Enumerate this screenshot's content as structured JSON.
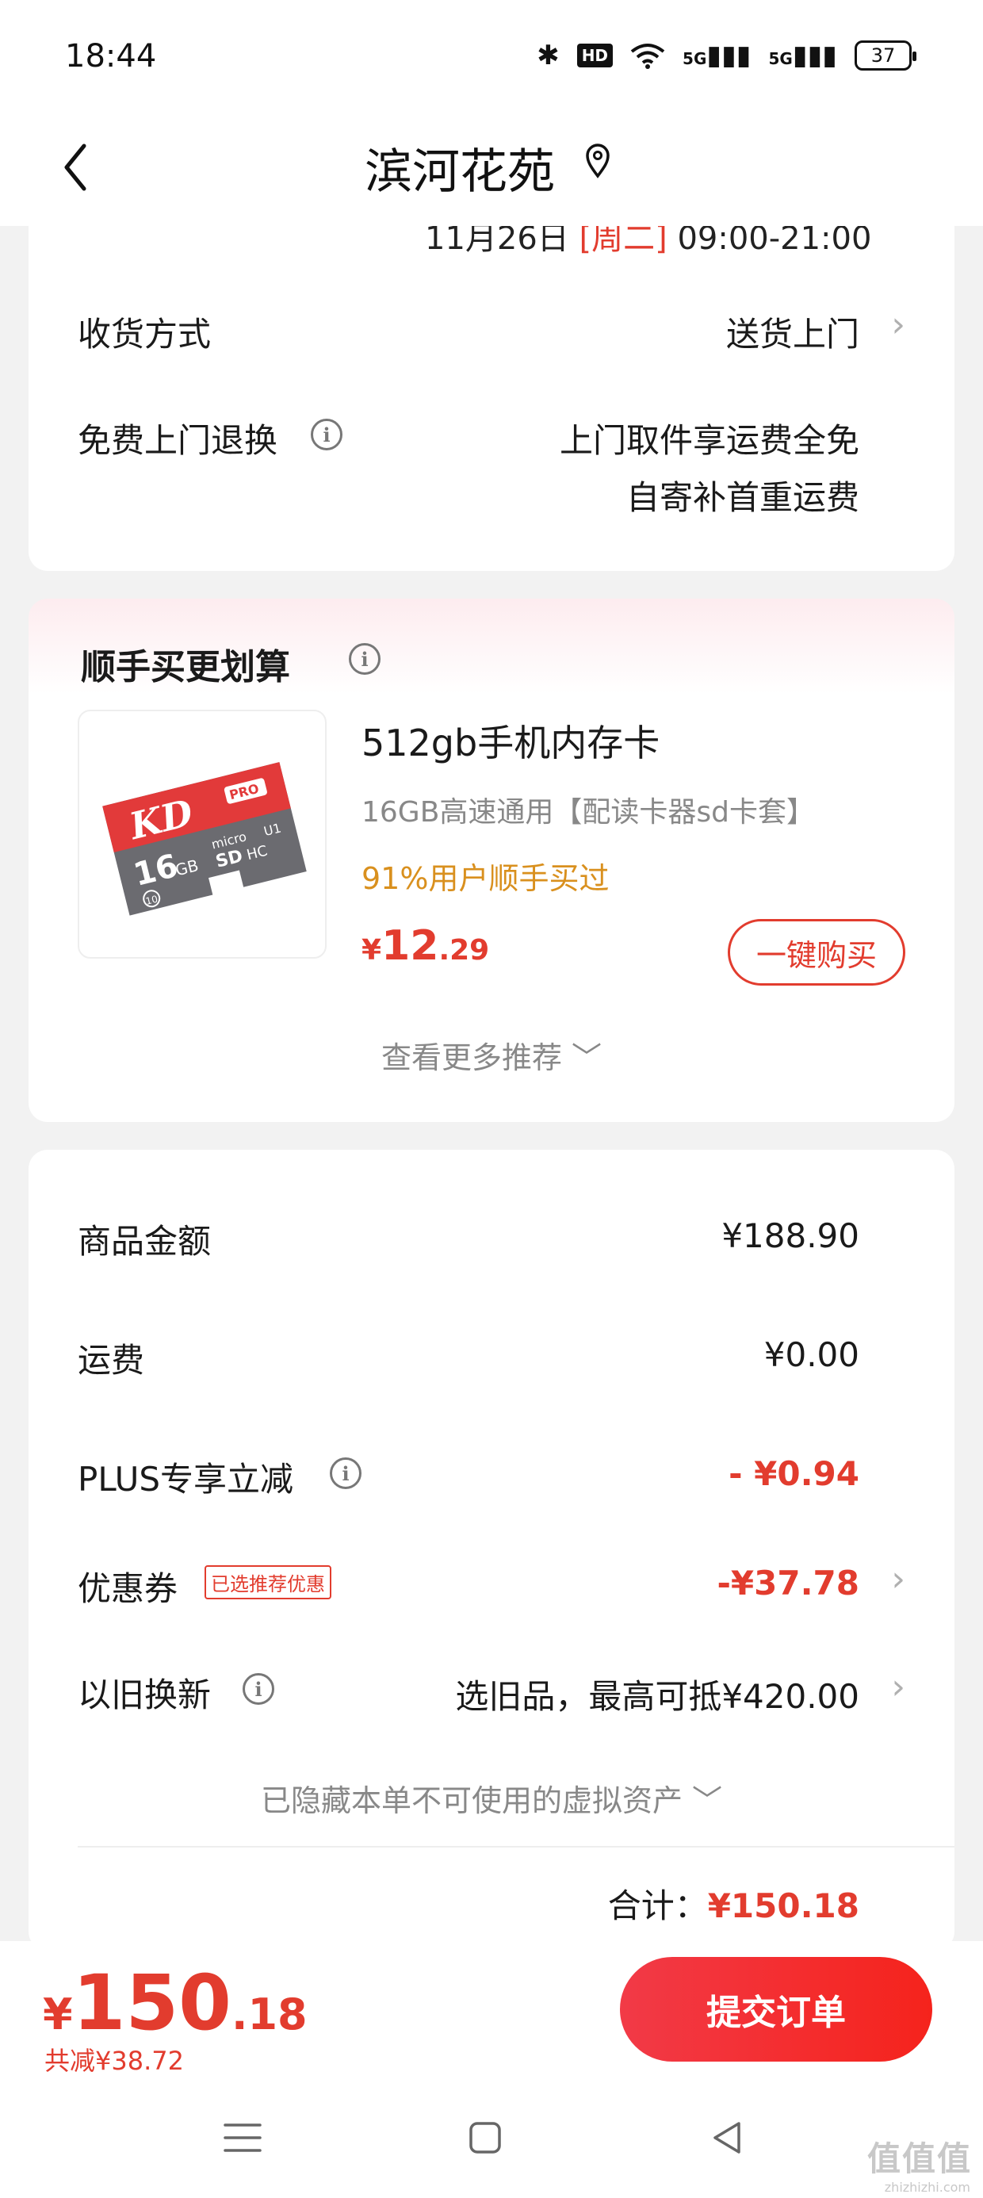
{
  "status_bar": {
    "time": "18:44",
    "hd": "HD",
    "signal1": "5G",
    "signal2": "5G",
    "battery": "37"
  },
  "nav": {
    "title": "滨河花苑"
  },
  "delivery": {
    "cut_line_prefix": "11月26日",
    "cut_line_day": "[周二]",
    "cut_line_time": "09:00-21:00",
    "method_label": "收货方式",
    "method_value": "送货上门",
    "return_label": "免费上门退换",
    "return_value_line1": "上门取件享运费全免",
    "return_value_line2": "自寄补首重运费"
  },
  "recommend": {
    "title": "顺手买更划算",
    "product": {
      "name": "512gb手机内存卡",
      "desc": "16GB高速通用【配读卡器sd卡套】",
      "social": "91%用户顺手买过",
      "price_symbol": "¥",
      "price_int": "12",
      "price_dec": ".29",
      "image_text": {
        "brand": "KD",
        "badge": "PRO",
        "capacity": "16",
        "unit": "GB",
        "micro": "micro",
        "sd": "SD",
        "hc": "HC",
        "class": "10",
        "uhs": "U1"
      }
    },
    "buy_label": "一键购买",
    "more_label": "查看更多推荐"
  },
  "summary": {
    "goods_label": "商品金额",
    "goods_value": "¥188.90",
    "shipping_label": "运费",
    "shipping_value": "¥0.00",
    "plus_label": "PLUS专享立减",
    "plus_value": "- ¥0.94",
    "coupon_label": "优惠券",
    "coupon_badge": "已选推荐优惠",
    "coupon_value": "-¥37.78",
    "tradein_label": "以旧换新",
    "tradein_value": "选旧品，最高可抵¥420.00",
    "hidden_assets": "已隐藏本单不可使用的虚拟资产",
    "total_label": "合计：",
    "total_value": "¥150.18"
  },
  "bottom": {
    "price_symbol": "¥",
    "price_int": "150",
    "price_dec": ".18",
    "saved": "共减¥38.72",
    "submit": "提交订单"
  },
  "watermark": {
    "main": "值值值",
    "sub": "zhizhizhi.com"
  },
  "colors": {
    "accent_red": "#e23c2e",
    "social_orange": "#d9901e",
    "page_bg": "#f2f2f2"
  }
}
